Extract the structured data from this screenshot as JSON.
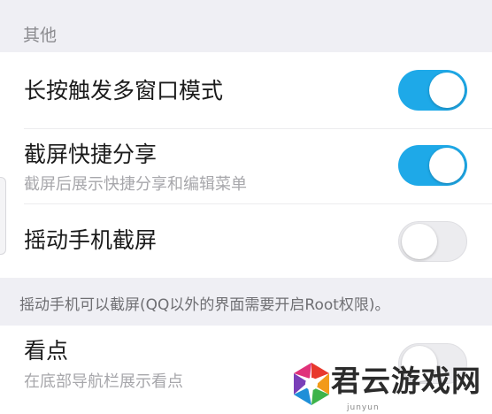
{
  "sections": {
    "other_header": "其他"
  },
  "settings": {
    "long_press": {
      "title": "长按触发多窗口模式",
      "enabled": true
    },
    "screenshot_share": {
      "title": "截屏快捷分享",
      "subtitle": "截屏后展示快捷分享和编辑菜单",
      "enabled": true
    },
    "shake_screenshot": {
      "title": "摇动手机截屏",
      "enabled": false
    },
    "shake_note": "摇动手机可以截屏(QQ以外的界面需要开启Root权限)。",
    "kandian": {
      "title": "看点",
      "subtitle": "在底部导航栏展示看点",
      "enabled": false
    }
  },
  "colors": {
    "toggle_on": "#1ea9e8",
    "toggle_off": "#ececef",
    "background": "#efeff4"
  },
  "watermark": {
    "text": "君云游戏网",
    "sub": "junyun"
  }
}
